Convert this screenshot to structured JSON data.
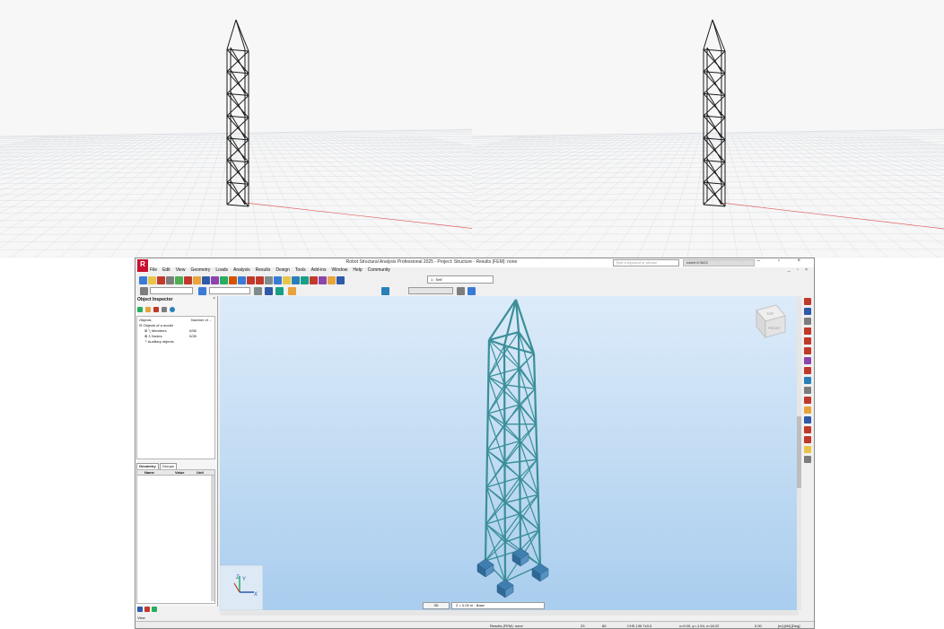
{
  "app": {
    "logo": "R",
    "title": "Robot Structural Analysis Professional 2025 - Project: Structure - Results (FEM): none",
    "search_placeholder": "Type a keyword or phrase",
    "help_text": "robert.fl 0623",
    "window_controls": "–  ▫  ×",
    "doc_controls": "_ ▫ ×"
  },
  "menu": [
    "File",
    "Edit",
    "View",
    "Geometry",
    "Loads",
    "Analysis",
    "Results",
    "Design",
    "Tools",
    "Add-ins",
    "Window",
    "Help",
    "Community"
  ],
  "toolbar": {
    "case_select": "1 : Self",
    "colors": [
      "#3a7bd5",
      "#e8c547",
      "#c0392b",
      "#7d7d7d",
      "#4caf50",
      "#c0392b",
      "#e8a33d",
      "#2e5aa8",
      "#8e44ad",
      "#27ae60",
      "#d35400",
      "#3a7bd5",
      "#c0392b",
      "#c0392b",
      "#7f8c8d",
      "#3a7bd5",
      "#e8c547",
      "#2980b9",
      "#16a085",
      "#c0392b",
      "#8e44ad",
      "#e8a33d",
      "#2e5aa8"
    ]
  },
  "inspector": {
    "title": "Object Inspector",
    "close": "×",
    "col_objects": "Objects",
    "col_count": "Number of ...",
    "items": [
      {
        "label": "Objects of a model",
        "count": ""
      },
      {
        "label": "Members",
        "count": "0/58"
      },
      {
        "label": "Nodes",
        "count": "0/28"
      },
      {
        "label": "Auxiliary objects",
        "count": ""
      }
    ],
    "tabs": [
      "Geometry",
      "Groups"
    ],
    "props_cols": [
      "Name",
      "Value",
      "Unit"
    ]
  },
  "viewcube": {
    "top": "TOP",
    "front": "FRONT"
  },
  "axes": {
    "x": "X",
    "y": "Y",
    "z": "Z"
  },
  "bottom": {
    "view_tab": "3D",
    "level": "Z = 0.00 m - Base",
    "view_label": "View"
  },
  "status": {
    "results": "Results (FEM): none",
    "n1": "23",
    "n2": "80",
    "section": "CHS 139.7x3.3",
    "coords": "x=0.00, y=-1.54, z=18.22",
    "angle": "0.00",
    "units": "[m] [kN] [Deg]"
  }
}
